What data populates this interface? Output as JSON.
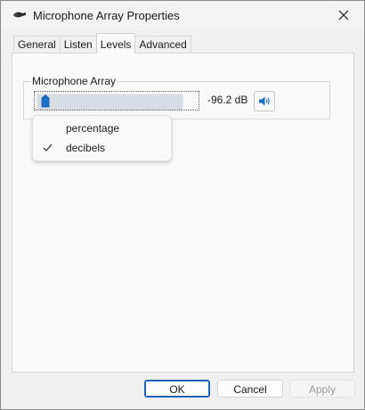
{
  "window": {
    "title": "Microphone Array Properties",
    "icon": "microphone-icon"
  },
  "tabs": [
    {
      "label": "General"
    },
    {
      "label": "Listen"
    },
    {
      "label": "Levels",
      "active": true
    },
    {
      "label": "Advanced"
    }
  ],
  "levels": {
    "group_label": "Microphone Array",
    "value_text": "-96.2 dB",
    "slider_level_fraction": 0.0,
    "speaker_icon": "speaker-icon"
  },
  "context_menu": {
    "items": [
      {
        "label": "percentage",
        "checked": false
      },
      {
        "label": "decibels",
        "checked": true
      }
    ]
  },
  "footer": {
    "ok_label": "OK",
    "cancel_label": "Cancel",
    "apply_label": "Apply"
  },
  "colors": {
    "accent": "#1f63b8",
    "slider_thumb": "#1a6fc9",
    "slider_track": "#d7dce2"
  }
}
